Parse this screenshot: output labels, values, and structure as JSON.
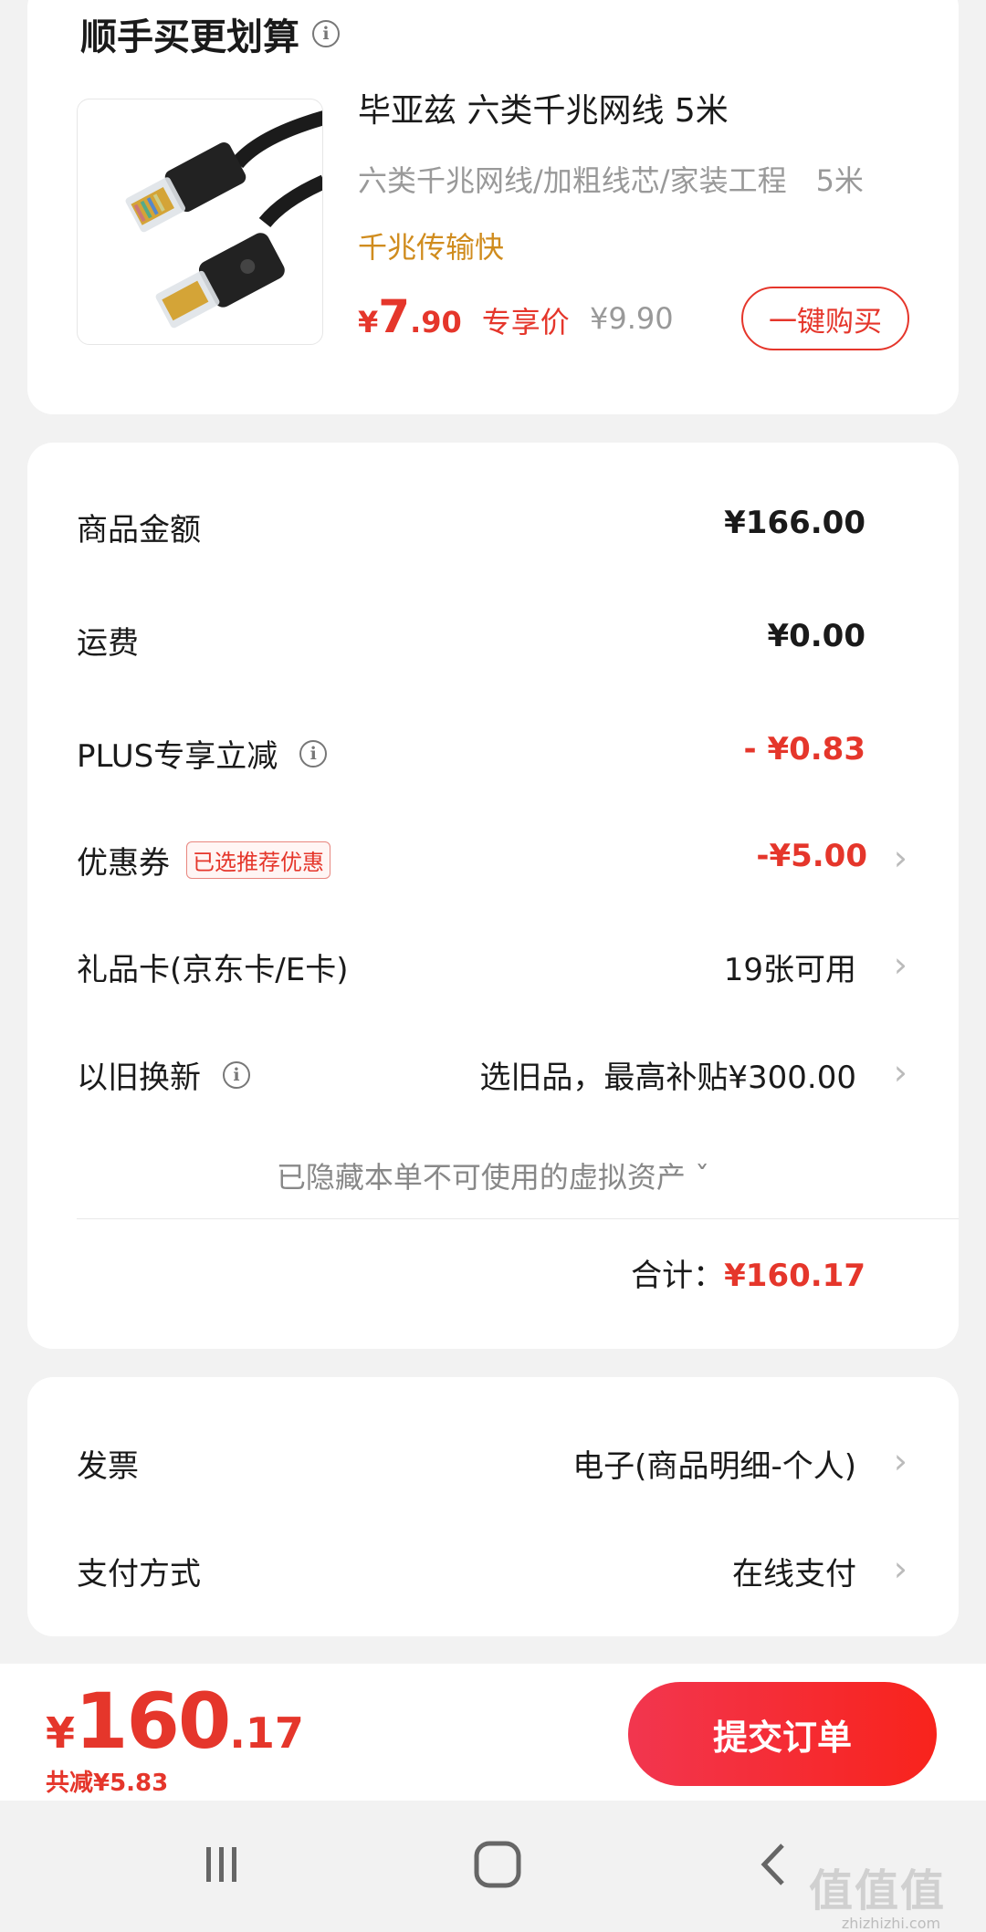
{
  "upsell": {
    "title": "顺手买更划算",
    "product_name": "毕亚兹 六类千兆网线 5米",
    "spec": "六类千兆网线/加粗线芯/家装工程　5米",
    "tag": "千兆传输快",
    "price_currency": "¥",
    "price_int": "7",
    "price_dec": ".90",
    "price_label": "专享价",
    "original_price": "¥9.90",
    "buy_button": "一键购买"
  },
  "summary": {
    "goods_amount_label": "商品金额",
    "goods_amount_value": "¥166.00",
    "shipping_label": "运费",
    "shipping_value": "¥0.00",
    "plus_label": "PLUS专享立减",
    "plus_value": "- ¥0.83",
    "coupon_label": "优惠券",
    "coupon_badge": "已选推荐优惠",
    "coupon_value": "-¥5.00",
    "giftcard_label": "礼品卡(京东卡/E卡)",
    "giftcard_value": "19张可用",
    "tradein_label": "以旧换新",
    "tradein_value": "选旧品，最高补贴¥300.00",
    "hidden_note": "已隐藏本单不可使用的虚拟资产 ˇ",
    "total_label": "合计：",
    "total_value": "¥160.17"
  },
  "invoice": {
    "invoice_label": "发票",
    "invoice_value": "电子(商品明细-个人)",
    "payment_label": "支付方式",
    "payment_value": "在线支付"
  },
  "bottom": {
    "currency": "¥",
    "total_int": "160",
    "total_dec": ".17",
    "saved": "共减¥5.83",
    "submit_button": "提交订单"
  },
  "watermark": {
    "text": "值值值",
    "sub": "zhizhizhi.com"
  },
  "icons": {
    "info": "info-icon",
    "chevron": "chevron-right-icon",
    "nav_recent": "recent-apps-icon",
    "nav_home": "home-icon",
    "nav_back": "back-icon"
  },
  "colors": {
    "accent_red": "#e5362b",
    "tag_orange": "#d08c1e"
  }
}
